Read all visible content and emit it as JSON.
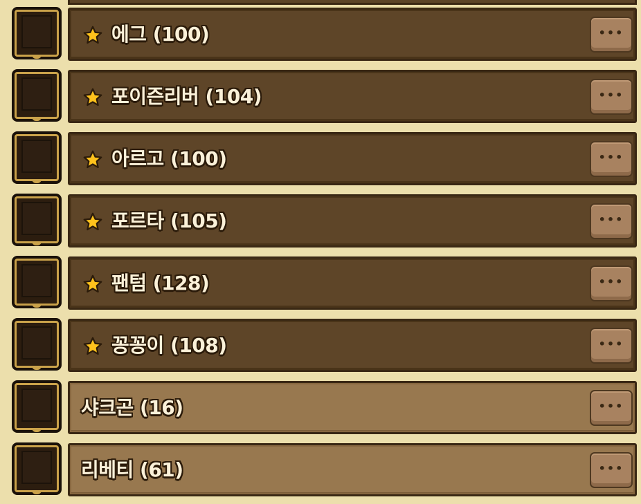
{
  "monster_list": [
    {
      "name": "에그 (100)",
      "favorite": true,
      "more_label": "•••"
    },
    {
      "name": "포이즌리버 (104)",
      "favorite": true,
      "more_label": "•••"
    },
    {
      "name": "아르고 (100)",
      "favorite": true,
      "more_label": "•••"
    },
    {
      "name": "포르타 (105)",
      "favorite": true,
      "more_label": "•••"
    },
    {
      "name": "팬텀 (128)",
      "favorite": true,
      "more_label": "•••"
    },
    {
      "name": "꽁꽁이 (108)",
      "favorite": true,
      "more_label": "•••"
    },
    {
      "name": "샤크곤 (16)",
      "favorite": false,
      "more_label": "•••"
    },
    {
      "name": "리베티 (61)",
      "favorite": false,
      "more_label": "•••"
    }
  ],
  "icons": {
    "favorite": "star-icon",
    "more": "more-dots-icon",
    "slot": "empty-item-slot"
  },
  "colors": {
    "background": "#ecdfac",
    "favorite_bar": "#5e4528",
    "plain_bar": "#98784f",
    "star": "#ffc21c",
    "slot_frame": "#caa24a"
  }
}
